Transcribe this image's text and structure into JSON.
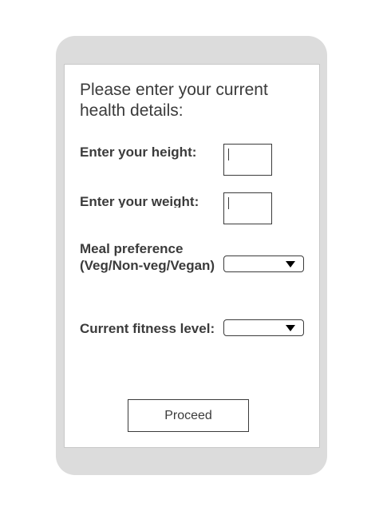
{
  "form": {
    "heading": "Please enter your current health details:",
    "height": {
      "label": "Enter your height:",
      "value": ""
    },
    "weight": {
      "label": "Enter your weight:",
      "value": ""
    },
    "meal_preference": {
      "label": "Meal preference (Veg/Non-veg/Vegan)",
      "selected": ""
    },
    "fitness_level": {
      "label": "Current fitness level:",
      "selected": ""
    },
    "proceed_label": "Proceed"
  },
  "icons": {
    "dropdown_arrow": "chevron-down-icon"
  },
  "colors": {
    "frame": "#dcdcdc",
    "text": "#3b3b3b",
    "arrow": "#000000"
  }
}
